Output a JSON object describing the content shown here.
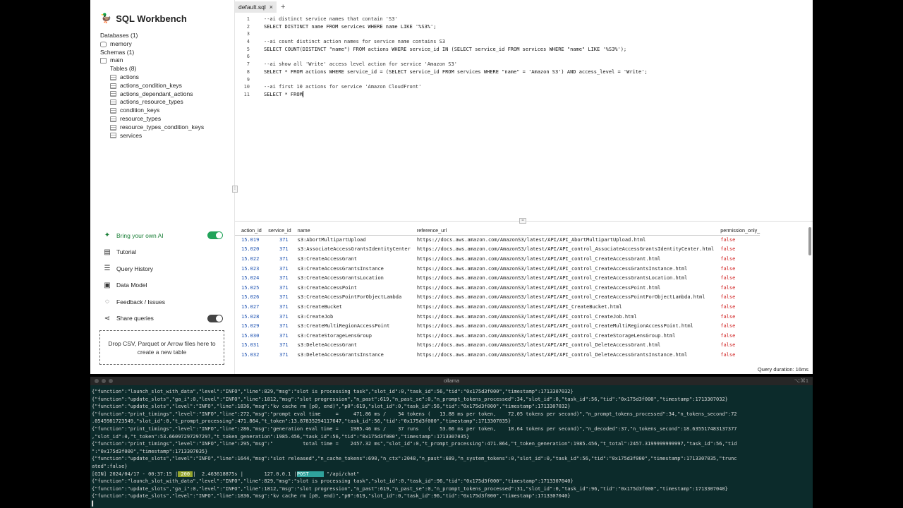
{
  "app": {
    "title": "SQL Workbench",
    "databases_label": "Databases (1)",
    "db_name": "memory",
    "schemas_label": "Schemas (1)",
    "schema_name": "main",
    "tables_label": "Tables (8)",
    "tables": [
      "actions",
      "actions_condition_keys",
      "actions_dependant_actions",
      "actions_resource_types",
      "condition_keys",
      "resource_types",
      "resource_types_condition_keys",
      "services"
    ]
  },
  "menu": {
    "byo_ai": "Bring your own AI",
    "tutorial": "Tutorial",
    "query_history": "Query History",
    "data_model": "Data Model",
    "feedback": "Feedback / Issues",
    "share": "Share queries",
    "dropzone": "Drop CSV, Parquet or Arrow files here to create a new table"
  },
  "editor": {
    "tab": "default.sql",
    "tab_close": "×",
    "tab_add": "+",
    "lines": [
      "--ai distinct service names that contain 'S3'",
      "SELECT DISTINCT name FROM services WHERE name LIKE '%S3%';",
      "",
      "--ai count distinct action names for service name contains S3",
      "SELECT COUNT(DISTINCT \"name\") FROM actions WHERE service_id IN (SELECT service_id FROM services WHERE \"name\" LIKE '%S3%');",
      "",
      "--ai show all 'Write' access level action for service 'Amazon S3'",
      "SELECT * FROM actions WHERE service_id = (SELECT service_id FROM services WHERE \"name\" = 'Amazon S3') AND access_level = 'Write';",
      "",
      "--ai first 10 actions for service 'Amazon CloudFront'",
      "SELECT * FROM"
    ]
  },
  "results": {
    "columns": [
      "action_id",
      "service_id",
      "name",
      "reference_url",
      "permission_only_"
    ],
    "rows": [
      [
        "15.019",
        "371",
        "s3:AbortMultipartUpload",
        "https://docs.aws.amazon.com/AmazonS3/latest/API/API_AbortMultipartUpload.html",
        "false"
      ],
      [
        "15.020",
        "371",
        "s3:AssociateAccessGrantsIdentityCenter",
        "https://docs.aws.amazon.com/AmazonS3/latest/API/API_control_AssociateAccessGrantsIdentityCenter.html",
        "false"
      ],
      [
        "15.022",
        "371",
        "s3:CreateAccessGrant",
        "https://docs.aws.amazon.com/AmazonS3/latest/API/API_control_CreateAccessGrant.html",
        "false"
      ],
      [
        "15.023",
        "371",
        "s3:CreateAccessGrantsInstance",
        "https://docs.aws.amazon.com/AmazonS3/latest/API/API_control_CreateAccessGrantsInstance.html",
        "false"
      ],
      [
        "15.024",
        "371",
        "s3:CreateAccessGrantsLocation",
        "https://docs.aws.amazon.com/AmazonS3/latest/API/API_control_CreateAccessGrantsLocation.html",
        "false"
      ],
      [
        "15.025",
        "371",
        "s3:CreateAccessPoint",
        "https://docs.aws.amazon.com/AmazonS3/latest/API/API_control_CreateAccessPoint.html",
        "false"
      ],
      [
        "15.026",
        "371",
        "s3:CreateAccessPointForObjectLambda",
        "https://docs.aws.amazon.com/AmazonS3/latest/API/API_control_CreateAccessPointForObjectLambda.html",
        "false"
      ],
      [
        "15.027",
        "371",
        "s3:CreateBucket",
        "https://docs.aws.amazon.com/AmazonS3/latest/API/API_CreateBucket.html",
        "false"
      ],
      [
        "15.028",
        "371",
        "s3:CreateJob",
        "https://docs.aws.amazon.com/AmazonS3/latest/API/API_control_CreateJob.html",
        "false"
      ],
      [
        "15.029",
        "371",
        "s3:CreateMultiRegionAccessPoint",
        "https://docs.aws.amazon.com/AmazonS3/latest/API/API_control_CreateMultiRegionAccessPoint.html",
        "false"
      ],
      [
        "15.030",
        "371",
        "s3:CreateStorageLensGroup",
        "https://docs.aws.amazon.com/AmazonS3/latest/API/API_control_CreateStorageLensGroup.html",
        "false"
      ],
      [
        "15.031",
        "371",
        "s3:DeleteAccessGrant",
        "https://docs.aws.amazon.com/AmazonS3/latest/API/API_control_DeleteAccessGrant.html",
        "false"
      ],
      [
        "15.032",
        "371",
        "s3:DeleteAccessGrantsInstance",
        "https://docs.aws.amazon.com/AmazonS3/latest/API/API_control_DeleteAccessGrantsInstance.html",
        "false"
      ]
    ],
    "duration": "Query duration: 16ms"
  },
  "terminal": {
    "title": "ollama",
    "shortcut": "⌥⌘1",
    "lines": [
      "{\"function\":\"launch_slot_with_data\",\"level\":\"INFO\",\"line\":829,\"msg\":\"slot is processing task\",\"slot_id\":0,\"task_id\":56,\"tid\":\"0x175d3f000\",\"timestamp\":1713307032}",
      "{\"function\":\"update_slots\",\"ga_i\":0,\"level\":\"INFO\",\"line\":1812,\"msg\":\"slot progression\",\"n_past\":619,\"n_past_se\":0,\"n_prompt_tokens_processed\":34,\"slot_id\":0,\"task_id\":56,\"tid\":\"0x175d3f000\",\"timestamp\":1713307032}",
      "{\"function\":\"update_slots\",\"level\":\"INFO\",\"line\":1836,\"msg\":\"kv cache rm [p0, end)\",\"p0\":619,\"slot_id\":0,\"task_id\":56,\"tid\":\"0x175d3f000\",\"timestamp\":1713307032}",
      "{\"function\":\"print_timings\",\"level\":\"INFO\",\"line\":272,\"msg\":\"prompt eval time     =     471.86 ms /    34 tokens (   13.88 ms per token,    72.05 tokens per second)\",\"n_prompt_tokens_processed\":34,\"n_tokens_second\":72",
      ".0545981723549,\"slot_id\":0,\"t_prompt_processing\":471.864,\"t_token\":13.87835294117647,\"task_id\":56,\"tid\":\"0x175d3f000\",\"timestamp\":1713307035}",
      "{\"function\":\"print_timings\",\"level\":\"INFO\",\"line\":286,\"msg\":\"generation eval time =    1985.46 ms /    37 runs   (   53.66 ms per token,    18.64 tokens per second)\",\"n_decoded\":37,\"n_tokens_second\":18.635517483137377",
      ",\"slot_id\":0,\"t_token\":53.66097297297297,\"t_token_generation\":1985.456,\"task_id\":56,\"tid\":\"0x175d3f000\",\"timestamp\":1713307035}",
      "{\"function\":\"print_timings\",\"level\":\"INFO\",\"line\":295,\"msg\":\"          total time =    2457.32 ms\",\"slot_id\":0,\"t_prompt_processing\":471.864,\"t_token_generation\":1985.456,\"t_total\":2457.3199999999997,\"task_id\":56,\"tid",
      "\":\"0x175d3f000\",\"timestamp\":1713307035}",
      "{\"function\":\"update_slots\",\"level\":\"INFO\",\"line\":1644,\"msg\":\"slot released\",\"n_cache_tokens\":690,\"n_ctx\":2048,\"n_past\":689,\"n_system_tokens\":0,\"slot_id\":0,\"task_id\":56,\"tid\":\"0x175d3f000\",\"timestamp\":1713307035,\"trunc",
      "ated\":false}",
      "GIN_LINE",
      "{\"function\":\"launch_slot_with_data\",\"level\":\"INFO\",\"line\":829,\"msg\":\"slot is processing task\",\"slot_id\":0,\"task_id\":96,\"tid\":\"0x175d3f000\",\"timestamp\":1713307040}",
      "{\"function\":\"update_slots\",\"ga_i\":0,\"level\":\"INFO\",\"line\":1812,\"msg\":\"slot progression\",\"n_past\":619,\"n_past_se\":0,\"n_prompt_tokens_processed\":31,\"slot_id\":0,\"task_id\":96,\"tid\":\"0x175d3f000\",\"timestamp\":1713307040}",
      "{\"function\":\"update_slots\",\"level\":\"INFO\",\"line\":1836,\"msg\":\"kv cache rm [p0, end)\",\"p0\":619,\"slot_id\":0,\"task_id\":96,\"tid\":\"0x175d3f000\",\"timestamp\":1713307040}",
      "▌"
    ],
    "gin": {
      "prefix": "[GIN] 2024/04/17 - 00:37:15 |",
      "status": " 200 ",
      "mid": "|  2.463618875s |       127.0.0.1 |",
      "method": "POST     ",
      "path": " \"/api/chat\""
    }
  }
}
